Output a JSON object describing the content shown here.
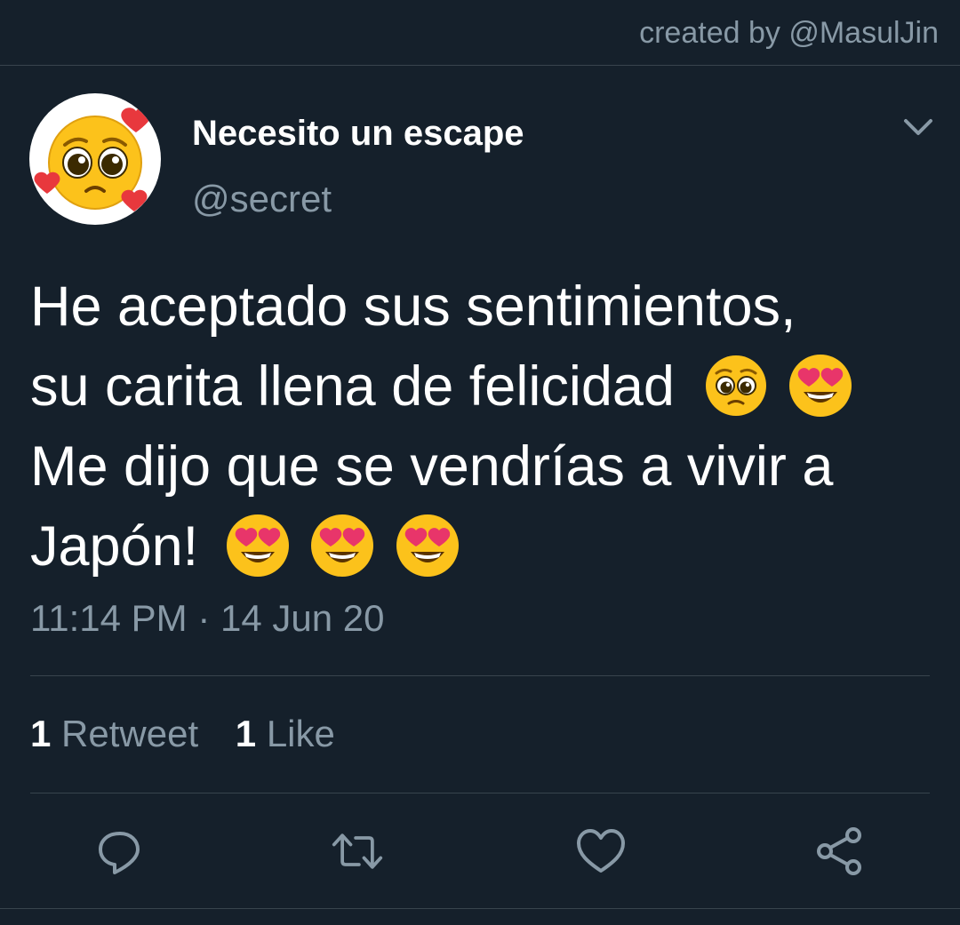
{
  "credit": "created by @MasulJin",
  "author": {
    "name": "Necesito un escape",
    "handle": "@secret",
    "avatar_icon": "pleading-face-with-hearts-emoji"
  },
  "tweet": {
    "line1": "He aceptado sus sentimientos,",
    "line2": "su carita llena de felicidad",
    "line3": "Me dijo que se vendrías a vivir a",
    "line4": "Japón!",
    "emojis_line2": [
      "pleading-face-emoji",
      "heart-eyes-emoji"
    ],
    "emojis_line4": [
      "heart-eyes-emoji",
      "heart-eyes-emoji",
      "heart-eyes-emoji"
    ]
  },
  "timestamp": "11:14 PM · 14 Jun 20",
  "stats": {
    "retweet_count": "1",
    "retweet_label": "Retweet",
    "like_count": "1",
    "like_label": "Like"
  },
  "actions": [
    "reply-icon",
    "retweet-icon",
    "like-icon",
    "share-icon"
  ],
  "colors": {
    "background": "#15202b",
    "secondary_text": "#8899a6",
    "divider": "#38444d"
  }
}
